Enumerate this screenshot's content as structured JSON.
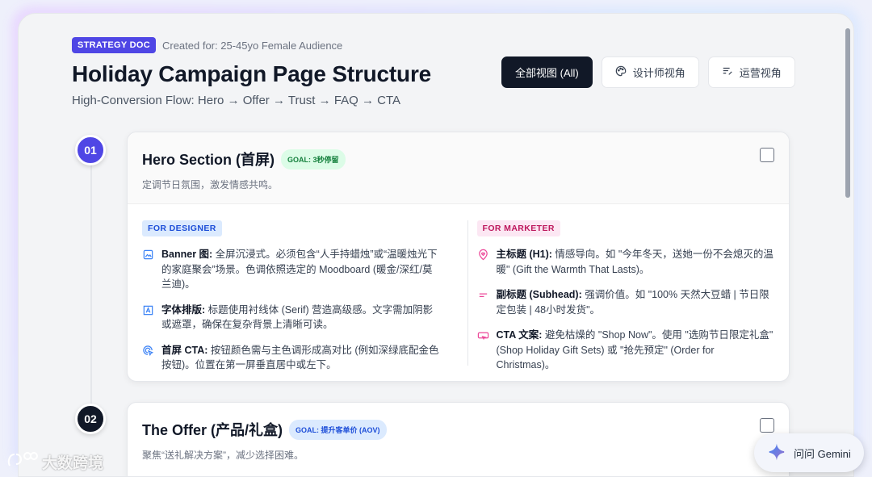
{
  "header": {
    "badge": "STRATEGY DOC",
    "created": "Created for: 25-45yo Female Audience",
    "title": "Holiday Campaign Page Structure",
    "subtitle": "High-Conversion Flow: Hero → Offer → Trust → FAQ → CTA"
  },
  "views": [
    {
      "label": "全部视图 (All)",
      "icon": "none",
      "active": true
    },
    {
      "label": "设计师视角",
      "icon": "palette-icon",
      "active": false
    },
    {
      "label": "运营视角",
      "icon": "edit-lines-icon",
      "active": false
    }
  ],
  "sections": [
    {
      "step": "01",
      "title": "Hero Section (首屏)",
      "goal": "GOAL: 3秒停留",
      "desc": "定调节日氛围，激发情感共鸣。",
      "designer_label": "FOR DESIGNER",
      "marketer_label": "FOR MARKETER",
      "designer_items": [
        {
          "icon": "image-icon",
          "bold": "Banner 图:",
          "text": " 全屏沉浸式。必须包含“人手持蜡烛”或“温暖烛光下的家庭聚会”场景。色调依照选定的 Moodboard (暖金/深红/莫兰迪)。"
        },
        {
          "icon": "text-frame-icon",
          "bold": "字体排版:",
          "text": " 标题使用衬线体 (Serif) 营造高级感。文字需加阴影或遮罩，确保在复杂背景上清晰可读。"
        },
        {
          "icon": "click-target-icon",
          "bold": "首屏 CTA:",
          "text": " 按钮颜色需与主色调形成高对比 (例如深绿底配金色按钮)。位置在第一屏垂直居中或左下。"
        }
      ],
      "marketer_items": [
        {
          "icon": "heart-pin-icon",
          "bold": "主标题 (H1):",
          "text": " 情感导向。如 \"今年冬天，送她一份不会熄灭的温暖\" (Gift the Warmth That Lasts)。"
        },
        {
          "icon": "short-lines-icon",
          "bold": "副标题 (Subhead):",
          "text": " 强调价值。如 \"100% 天然大豆蜡 | 节日限定包装 | 48小时发货\"。"
        },
        {
          "icon": "button-icon",
          "bold": "CTA 文案:",
          "text": " 避免枯燥的 \"Shop Now\"。使用 \"选购节日限定礼盒\" (Shop Holiday Gift Sets) 或 \"抢先预定\" (Order for Christmas)。"
        }
      ]
    },
    {
      "step": "02",
      "title": "The Offer (产品/礼盒)",
      "goal": "GOAL: 提升客单价 (AOV)",
      "desc": "聚焦“送礼解决方案”，减少选择困难。"
    }
  ],
  "gemini": {
    "label": "问问 Gemini"
  },
  "watermark": {
    "text": "大数跨境"
  },
  "colors": {
    "accent": "#4f46e5",
    "dark": "#111827"
  }
}
